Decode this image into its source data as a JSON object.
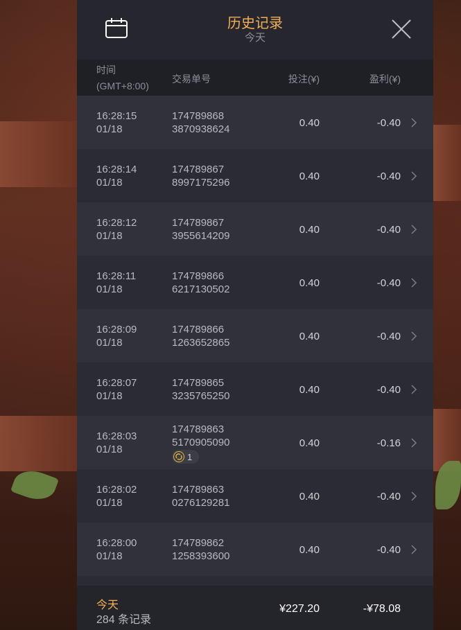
{
  "header": {
    "title": "历史记录",
    "subtitle": "今天",
    "calendar_icon": "calendar-icon",
    "close_icon": "close-icon"
  },
  "columns": {
    "time_label": "时间",
    "timezone": "(GMT+8:00)",
    "txn_label": "交易单号",
    "bet_label": "投注(¥)",
    "profit_label": "盈利(¥)"
  },
  "rows": [
    {
      "time": "16:28:15",
      "date": "01/18",
      "id1": "174789868",
      "id2": "3870938624",
      "bet": "0.40",
      "profit": "-0.40"
    },
    {
      "time": "16:28:14",
      "date": "01/18",
      "id1": "174789867",
      "id2": "8997175296",
      "bet": "0.40",
      "profit": "-0.40"
    },
    {
      "time": "16:28:12",
      "date": "01/18",
      "id1": "174789867",
      "id2": "3955614209",
      "bet": "0.40",
      "profit": "-0.40"
    },
    {
      "time": "16:28:11",
      "date": "01/18",
      "id1": "174789866",
      "id2": "6217130502",
      "bet": "0.40",
      "profit": "-0.40"
    },
    {
      "time": "16:28:09",
      "date": "01/18",
      "id1": "174789866",
      "id2": "1263652865",
      "bet": "0.40",
      "profit": "-0.40"
    },
    {
      "time": "16:28:07",
      "date": "01/18",
      "id1": "174789865",
      "id2": "3235765250",
      "bet": "0.40",
      "profit": "-0.40"
    },
    {
      "time": "16:28:03",
      "date": "01/18",
      "id1": "174789863",
      "id2": "5170905090",
      "bet": "0.40",
      "profit": "-0.16",
      "badge": "1"
    },
    {
      "time": "16:28:02",
      "date": "01/18",
      "id1": "174789863",
      "id2": "0276129281",
      "bet": "0.40",
      "profit": "-0.40"
    },
    {
      "time": "16:28:00",
      "date": "01/18",
      "id1": "174789862",
      "id2": "1258393600",
      "bet": "0.40",
      "profit": "-0.40"
    }
  ],
  "footer": {
    "today": "今天",
    "count": "284 条记录",
    "total_bet": "¥227.20",
    "total_profit": "-¥78.08"
  },
  "colors": {
    "accent": "#f4b055",
    "panel": "#2b2b33",
    "row_alt": "#31313b",
    "header": "#26262e"
  }
}
